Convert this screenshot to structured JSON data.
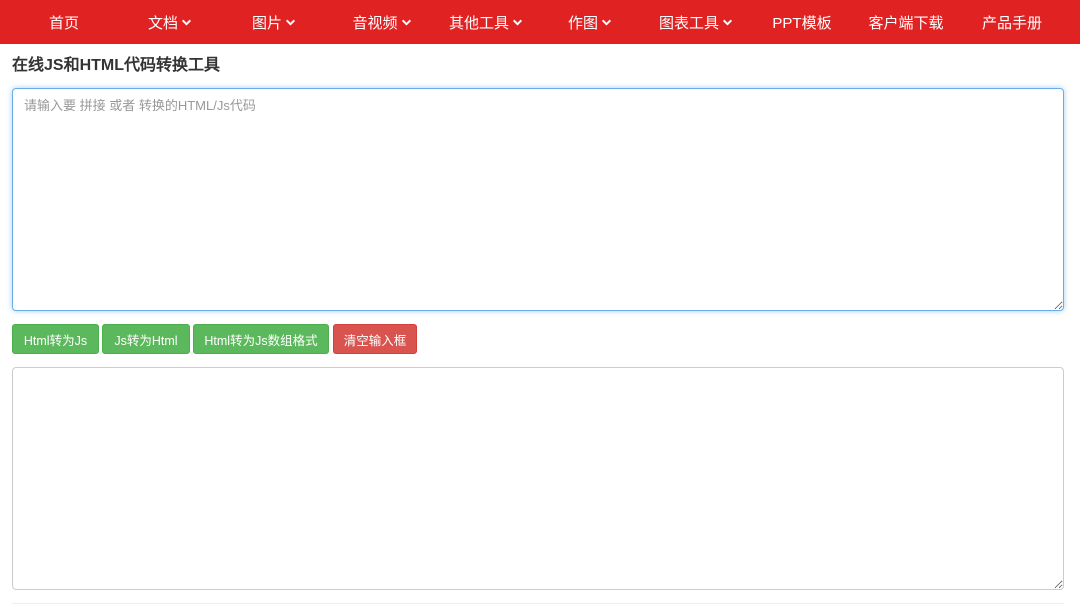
{
  "nav": {
    "items": [
      {
        "label": "首页",
        "dropdown": false
      },
      {
        "label": "文档",
        "dropdown": true
      },
      {
        "label": "图片",
        "dropdown": true
      },
      {
        "label": "音视频",
        "dropdown": true
      },
      {
        "label": "其他工具",
        "dropdown": true
      },
      {
        "label": "作图",
        "dropdown": true
      },
      {
        "label": "图表工具",
        "dropdown": true
      },
      {
        "label": "PPT模板",
        "dropdown": false
      },
      {
        "label": "客户端下载",
        "dropdown": false
      },
      {
        "label": "产品手册",
        "dropdown": false
      }
    ]
  },
  "colors": {
    "nav_bg": "#e02222",
    "btn_green": "#5cb85c",
    "btn_red": "#d9534f"
  },
  "page": {
    "title": "在线JS和HTML代码转换工具"
  },
  "input": {
    "placeholder": "请输入要 拼接 或者 转换的HTML/Js代码",
    "value": ""
  },
  "buttons": {
    "html_to_js": "Html转为Js",
    "js_to_html": "Js转为Html",
    "html_to_js_array": "Html转为Js数组格式",
    "clear": "清空输入框"
  },
  "output": {
    "value": ""
  }
}
